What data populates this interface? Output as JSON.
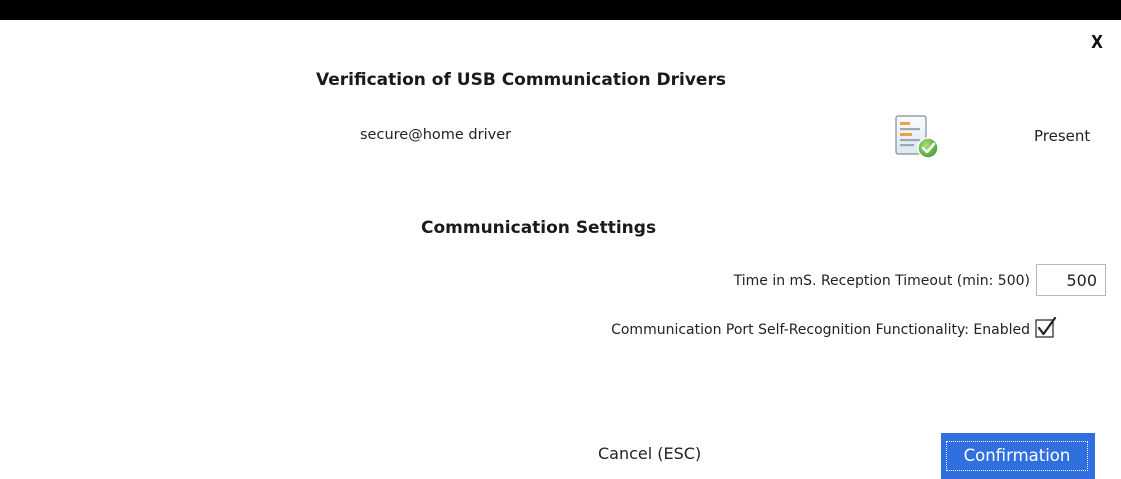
{
  "dialog": {
    "close_label": "X",
    "title": "Verification of USB Communication Drivers"
  },
  "drivers": [
    {
      "name": "secure@home driver",
      "icon": "document-check-icon",
      "status": "Present"
    }
  ],
  "settings": {
    "title": "Communication Settings",
    "timeout_label": "Time in mS. Reception Timeout (min: 500)",
    "timeout_value": "500",
    "self_recognition_label": "Communication Port Self-Recognition Functionality: Enabled",
    "self_recognition_enabled": true
  },
  "actions": {
    "cancel_label": "Cancel (ESC)",
    "confirm_label": "Confirmation"
  },
  "colors": {
    "top_bar": "#000000",
    "confirm_button": "#2f6fe0",
    "check_badge": "#6cc04a"
  }
}
